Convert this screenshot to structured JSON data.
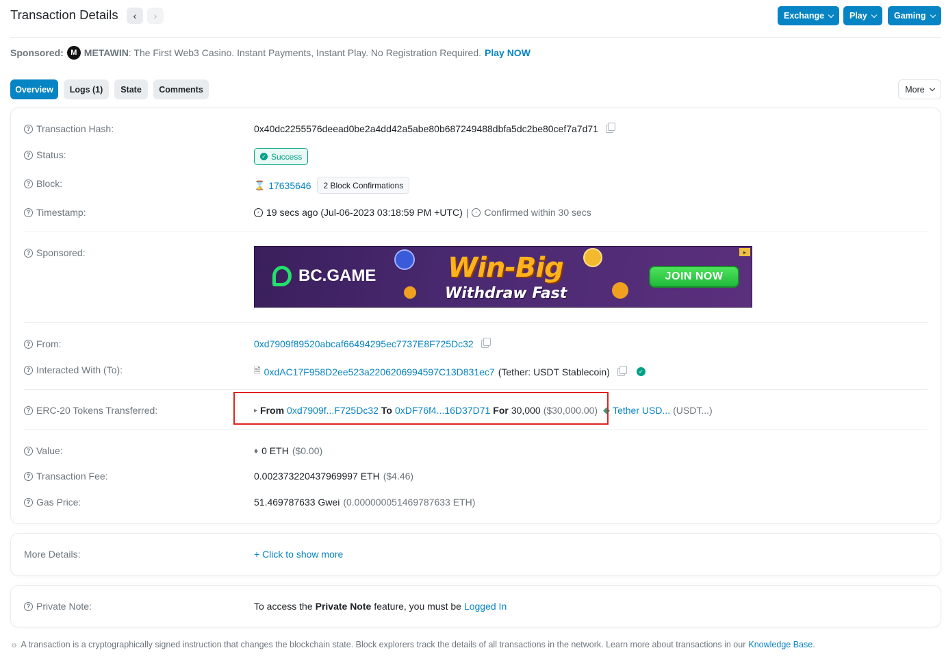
{
  "header": {
    "title": "Transaction Details",
    "buttons": [
      "Exchange",
      "Play",
      "Gaming"
    ]
  },
  "sponsor_bar": {
    "label": "Sponsored:",
    "brand": "METAWIN",
    "text": ": The First Web3 Casino. Instant Payments, Instant Play. No Registration Required.",
    "cta": "Play NOW"
  },
  "tabs": {
    "items": [
      "Overview",
      "Logs (1)",
      "State",
      "Comments"
    ],
    "active": "Overview",
    "more": "More"
  },
  "details": {
    "tx_hash": {
      "label": "Transaction Hash:",
      "value": "0x40dc2255576deead0be2a4dd42a5abe80b687249488dbfa5dc2be80cef7a7d71"
    },
    "status": {
      "label": "Status:",
      "value": "Success"
    },
    "block": {
      "label": "Block:",
      "number": "17635646",
      "confirmations": "2 Block Confirmations"
    },
    "timestamp": {
      "label": "Timestamp:",
      "value": "19 secs ago (Jul-06-2023 03:18:59 PM +UTC)",
      "sep": "|",
      "confirmed": "Confirmed within 30 secs"
    },
    "sponsored": {
      "label": "Sponsored:",
      "banner": {
        "brand": "BC.GAME",
        "headline": "Win-Big",
        "subline": "Withdraw Fast",
        "cta": "JOIN NOW"
      }
    },
    "from": {
      "label": "From:",
      "value": "0xd7909f89520abcaf66494295ec7737E8F725Dc32"
    },
    "to": {
      "label": "Interacted With (To):",
      "address": "0xdAC17F958D2ee523a2206206994597C13D831ec7",
      "name": "(Tether: USDT Stablecoin)"
    },
    "erc20": {
      "label": "ERC-20 Tokens Transferred:",
      "from_word": "From",
      "from": "0xd7909f...F725Dc32",
      "to_word": "To",
      "to": "0xDF76f4...16D37D71",
      "for_word": "For",
      "amount": "30,000",
      "usd": "($30,000.00)",
      "token": "Tether USD...",
      "symbol": "(USDT...)"
    },
    "value": {
      "label": "Value:",
      "value": "0 ETH",
      "usd": "($0.00)"
    },
    "fee": {
      "label": "Transaction Fee:",
      "value": "0.002373220437969997 ETH",
      "usd": "($4.46)"
    },
    "gas": {
      "label": "Gas Price:",
      "value": "51.469787633 Gwei",
      "eth": "(0.000000051469787633 ETH)"
    }
  },
  "more_details": {
    "label": "More Details:",
    "link": "+ Click to show more"
  },
  "private_note": {
    "label": "Private Note:",
    "prefix": "To access the",
    "feature": "Private Note",
    "middle": "feature, you must be",
    "link": "Logged In"
  },
  "footer": {
    "text": "A transaction is a cryptographically signed instruction that changes the blockchain state. Block explorers track the details of all transactions in the network. Learn more about transactions in our",
    "link": "Knowledge Base",
    "end": "."
  },
  "colors": {
    "accent": "#0784c3",
    "success": "#00a186",
    "highlight": "#e0211f"
  }
}
